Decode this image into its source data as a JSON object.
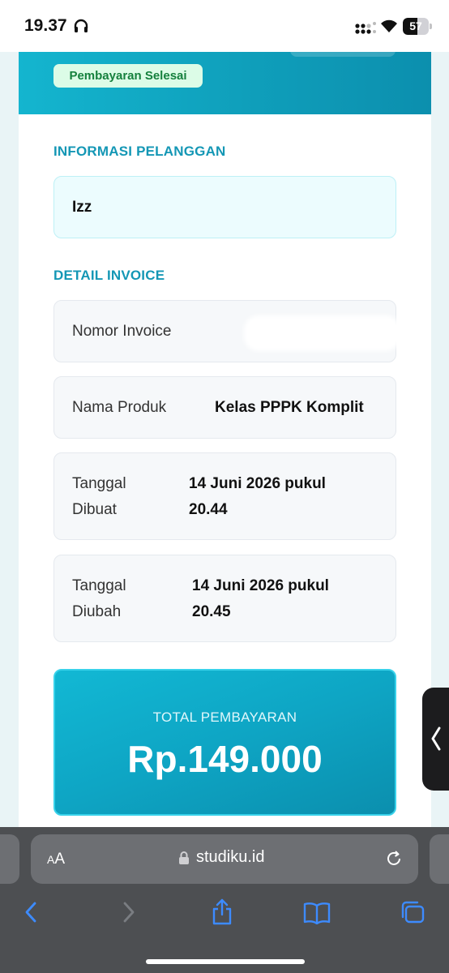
{
  "status_bar": {
    "time": "19.37",
    "battery_level": 57,
    "battery_text": "57",
    "icons": [
      "headphone-icon",
      "signal-icon",
      "wifi-icon",
      "battery-icon"
    ]
  },
  "header": {
    "status_badge": "Pembayaran Selesai",
    "badge_colors": {
      "background": "#dcfce7",
      "text": "#15803d"
    },
    "accent_color": "#1497b5"
  },
  "customer_info": {
    "title": "INFORMASI PELANGGAN",
    "name": "Izz"
  },
  "invoice_detail": {
    "title": "DETAIL INVOICE",
    "rows": [
      {
        "label": "Nomor Invoice",
        "value": ""
      },
      {
        "label": "Nama Produk",
        "value": "Kelas PPPK Komplit"
      },
      {
        "label_line1": "Tanggal",
        "label_line2": "Dibuat",
        "value_line1": "14 Juni 2026 pukul",
        "value_line2": "20.44"
      },
      {
        "label_line1": "Tanggal",
        "label_line2": "Diubah",
        "value_line1": "14 Juni 2026 pukul",
        "value_line2": "20.45"
      }
    ]
  },
  "total": {
    "label": "TOTAL PEMBAYARAN",
    "amount": "Rp.149.000"
  },
  "browser": {
    "aa_small": "A",
    "aa_large": "A",
    "url": "studiku.id",
    "icons": [
      "lock-icon",
      "reload-icon",
      "back-icon",
      "forward-icon",
      "share-icon",
      "bookmarks-icon",
      "tabs-icon"
    ]
  }
}
